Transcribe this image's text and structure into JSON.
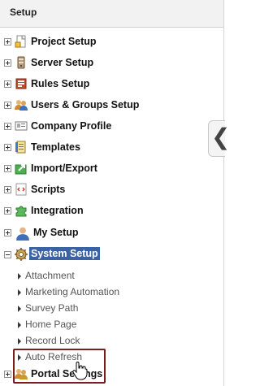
{
  "header": {
    "title": "Setup"
  },
  "tree": {
    "nodes": [
      {
        "label": "Project Setup",
        "icon": "project-setup-icon",
        "expanded": false
      },
      {
        "label": "Server Setup",
        "icon": "server-setup-icon",
        "expanded": false
      },
      {
        "label": "Rules Setup",
        "icon": "rules-setup-icon",
        "expanded": false
      },
      {
        "label": "Users & Groups Setup",
        "icon": "users-groups-icon",
        "expanded": false
      },
      {
        "label": "Company Profile",
        "icon": "company-profile-icon",
        "expanded": false
      },
      {
        "label": "Templates",
        "icon": "templates-icon",
        "expanded": false
      },
      {
        "label": "Import/Export",
        "icon": "import-export-icon",
        "expanded": false
      },
      {
        "label": "Scripts",
        "icon": "scripts-icon",
        "expanded": false
      },
      {
        "label": "Integration",
        "icon": "integration-icon",
        "expanded": false
      },
      {
        "label": "My Setup",
        "icon": "my-setup-icon",
        "expanded": false
      },
      {
        "label": "System Setup",
        "icon": "system-setup-icon",
        "expanded": true,
        "selected": true
      },
      {
        "label": "Portal Settings",
        "icon": "portal-settings-icon",
        "expanded": false
      }
    ],
    "system_setup_children": [
      "Attachment",
      "Marketing Automation",
      "Survey Path",
      "Home Page",
      "Record Lock",
      "Auto Refresh"
    ]
  },
  "colors": {
    "selection": "#3b62a3",
    "highlight_border": "#7b1d1d"
  },
  "collapse_handle": {
    "glyph": "❮"
  }
}
